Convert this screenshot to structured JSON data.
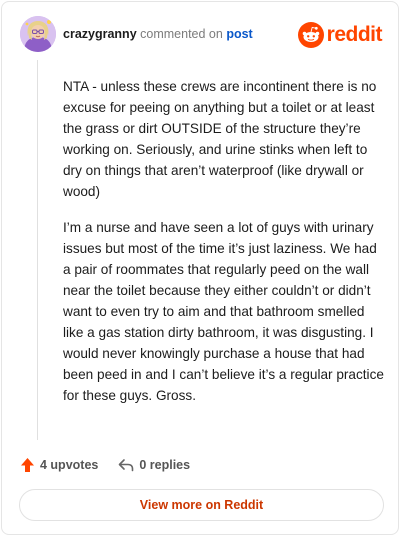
{
  "header": {
    "username": "crazygranny",
    "verb": "commented on",
    "post_link": "post",
    "brand": "reddit"
  },
  "comment": {
    "paragraphs": [
      "NTA - unless these crews are incontinent there is no excuse for peeing on anything but a toilet or at least the grass or dirt OUTSIDE of the structure they’re working on. Seriously, and urine stinks when left to dry on things that aren’t waterproof (like drywall or wood)",
      "I’m a nurse and have seen a lot of guys with urinary issues but most of the time it’s just laziness. We had a pair of roommates that regularly peed on the wall near the toilet because they either couldn’t or didn’t want to even try to aim and that bathroom smelled like a gas station dirty bathroom, it was disgusting. I would never knowingly purchase a house that had been peed in and I can’t believe it’s a regular practice for these guys. Gross."
    ]
  },
  "actions": {
    "upvotes": "4 upvotes",
    "replies": "0 replies"
  },
  "footer": {
    "view_more": "View more on Reddit"
  },
  "colors": {
    "brand": "#ff4500",
    "link": "#0a58ca",
    "view_more_text": "#cc3700"
  },
  "icons": {
    "avatar": "avatar-image",
    "brand": "reddit-logo-icon",
    "upvote": "upvote-arrow-icon",
    "reply": "reply-arrow-icon"
  }
}
